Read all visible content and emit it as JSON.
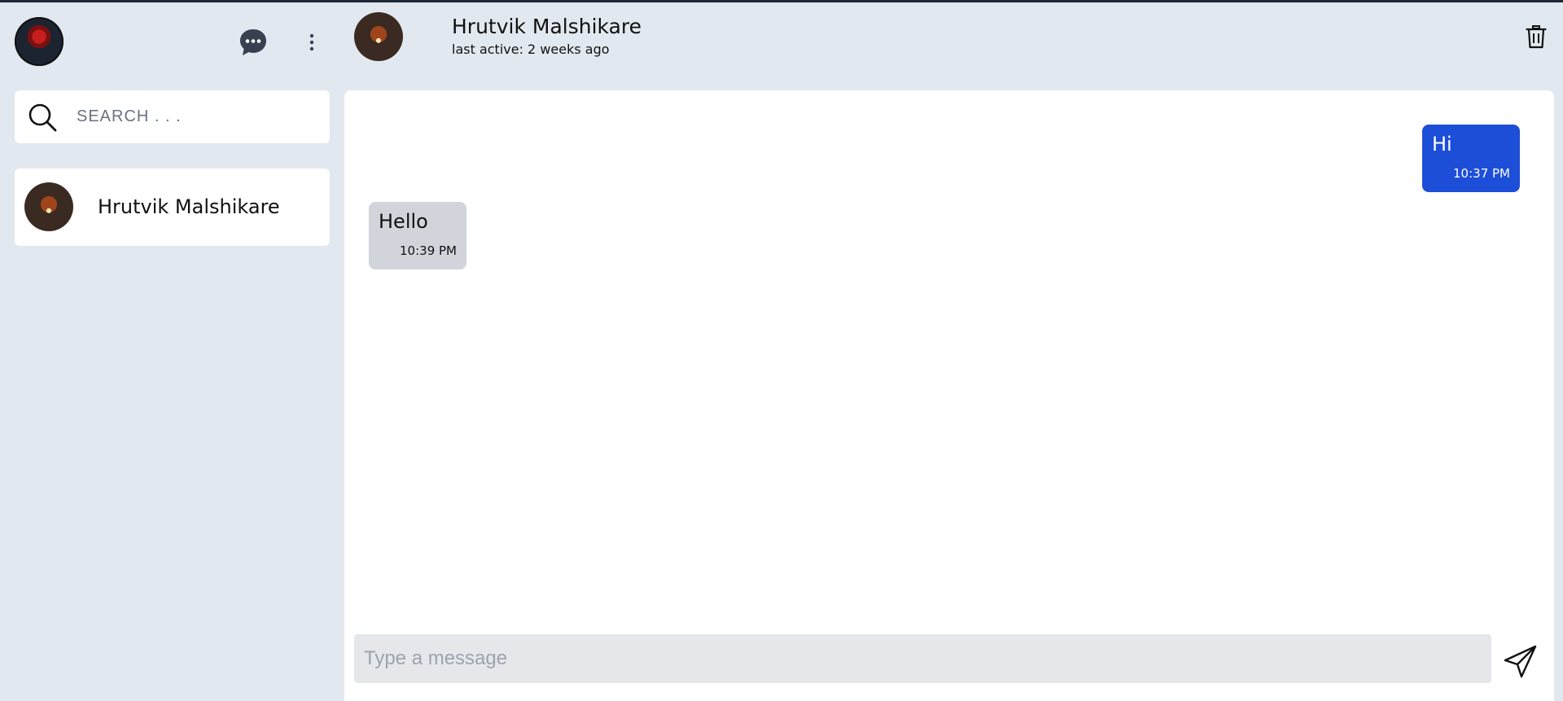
{
  "sidebar": {
    "search": {
      "placeholder": "SEARCH . . ."
    },
    "contacts": [
      {
        "name": "Hrutvik Malshikare"
      }
    ]
  },
  "chat": {
    "title": "Hrutvik Malshikare",
    "status": "last active: 2 weeks ago",
    "messages": [
      {
        "direction": "outgoing",
        "text": "Hi",
        "time": "10:37 PM"
      },
      {
        "direction": "incoming",
        "text": "Hello",
        "time": "10:39 PM"
      }
    ],
    "composer": {
      "placeholder": "Type a message"
    }
  },
  "colors": {
    "background": "#e2e8f0",
    "outgoing_bubble": "#1d4ed8",
    "incoming_bubble": "#d1d5db",
    "panel": "#ffffff"
  },
  "icons": [
    "chat-bubble-icon",
    "more-vertical-icon",
    "search-icon",
    "trash-icon",
    "send-icon"
  ]
}
